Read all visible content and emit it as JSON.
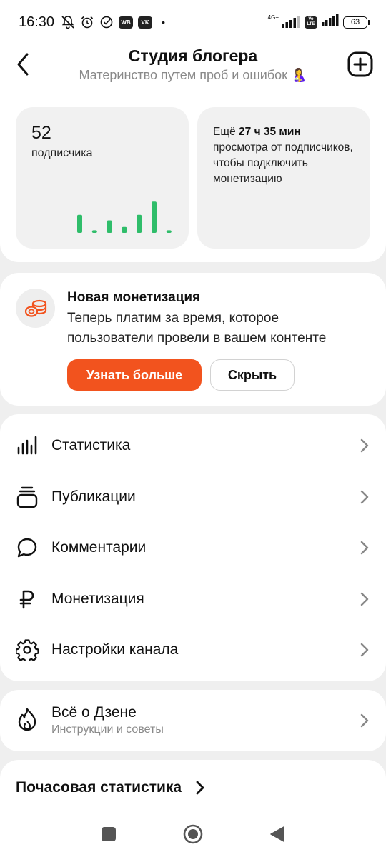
{
  "status_bar": {
    "time": "16:30",
    "badge_wb": "WB",
    "badge_vk": "VK",
    "dot": "•",
    "network_label": "4G+",
    "volte_label": "Vo LTE",
    "battery": "63"
  },
  "header": {
    "title": "Студия блогера",
    "subtitle": "Материнство путем проб и ошибок",
    "subtitle_emoji": "🤱"
  },
  "subscribers_card": {
    "count": "52",
    "label": "подписчика",
    "bars_relative_heights": [
      0.55,
      0.08,
      0.38,
      0.18,
      0.55,
      0.95,
      0.08
    ],
    "bar_color": "#2fbd6a"
  },
  "monetization_card": {
    "prefix": "Ещё ",
    "time_left": "27 ч 35 мин",
    "text": "просмотра от подписчиков, чтобы подключить монетизацию"
  },
  "promo": {
    "icon": "coins-icon",
    "title": "Новая монетизация",
    "description": "Теперь платим за время, которое пользователи провели в вашем контенте",
    "primary_button": "Узнать больше",
    "secondary_button": "Скрыть",
    "accent_color": "#f2531e"
  },
  "menu": {
    "items": [
      {
        "label": "Статистика",
        "icon": "bar-chart-icon"
      },
      {
        "label": "Публикации",
        "icon": "publications-icon"
      },
      {
        "label": "Комментарии",
        "icon": "comment-icon"
      },
      {
        "label": "Монетизация",
        "icon": "ruble-icon"
      },
      {
        "label": "Настройки канала",
        "icon": "gear-icon"
      }
    ]
  },
  "about": {
    "title": "Всё о Дзене",
    "subtitle": "Инструкции и советы",
    "icon": "flame-icon"
  },
  "hourly": {
    "title": "Почасовая статистика"
  },
  "navbar": {
    "icons": [
      "square-icon",
      "home-circle-icon",
      "back-triangle-icon"
    ]
  }
}
